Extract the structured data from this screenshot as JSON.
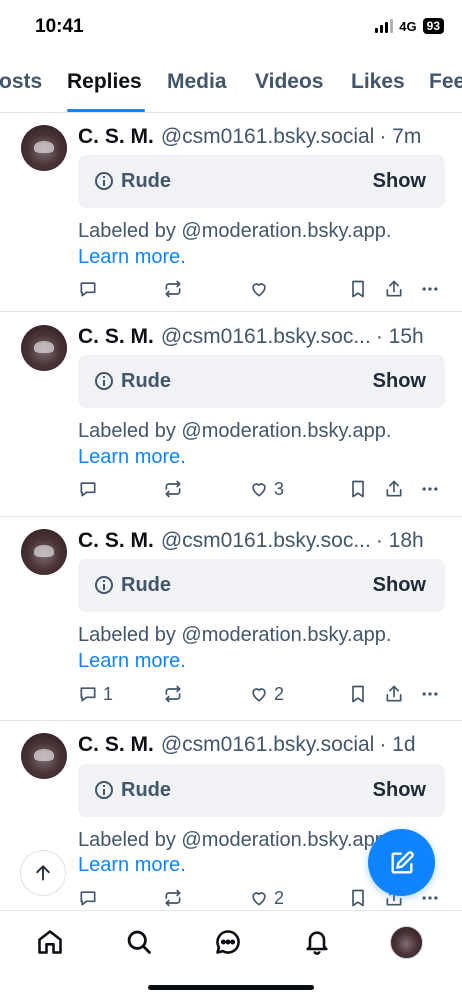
{
  "status_bar": {
    "time": "10:41",
    "network": "4G",
    "battery": "93"
  },
  "tabs": [
    {
      "label": "Posts",
      "visible_text": "osts",
      "active": false
    },
    {
      "label": "Replies",
      "active": true
    },
    {
      "label": "Media",
      "active": false
    },
    {
      "label": "Videos",
      "active": false
    },
    {
      "label": "Likes",
      "active": false
    },
    {
      "label": "Feeds",
      "visible_text": "Fee",
      "active": false
    }
  ],
  "posts": [
    {
      "name": "C. S. M.",
      "handle": "@csm0161.bsky.social",
      "time": "· 7m",
      "label": "Rude",
      "show": "Show",
      "labeled_by": "Labeled by @moderation.bsky.app.",
      "learn_more": "Learn more.",
      "reply_count": "",
      "like_count": ""
    },
    {
      "name": "C. S. M.",
      "handle": "@csm0161.bsky.soc...",
      "time": "· 15h",
      "label": "Rude",
      "show": "Show",
      "labeled_by": "Labeled by @moderation.bsky.app.",
      "learn_more": "Learn more.",
      "reply_count": "",
      "like_count": "3"
    },
    {
      "name": "C. S. M.",
      "handle": "@csm0161.bsky.soc...",
      "time": "· 18h",
      "label": "Rude",
      "show": "Show",
      "labeled_by": "Labeled by @moderation.bsky.app.",
      "learn_more": "Learn more.",
      "reply_count": "1",
      "like_count": "2"
    },
    {
      "name": "C. S. M.",
      "handle": "@csm0161.bsky.social",
      "time": "· 1d",
      "label": "Rude",
      "show": "Show",
      "labeled_by": "Labeled by @moderation.bsky.app.",
      "learn_more": "Learn more.",
      "reply_count": "",
      "like_count": "2"
    }
  ],
  "bottom_nav": [
    "home-icon",
    "search-icon",
    "chat-icon",
    "bell-icon",
    "profile-avatar"
  ],
  "colors": {
    "accent": "#1083fe",
    "muted_text": "#42566b",
    "label_bg": "#f0f2f5"
  }
}
